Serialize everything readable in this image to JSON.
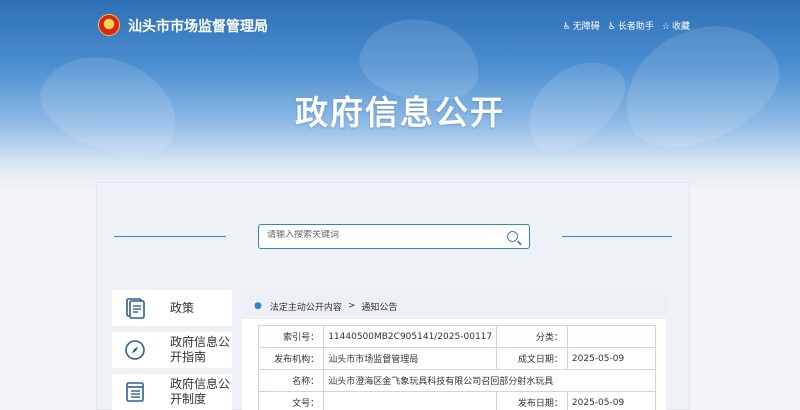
{
  "header": {
    "site_name": "汕头市市场监督管理局",
    "links": [
      {
        "icon": "accessibility-icon",
        "label": "无障碍"
      },
      {
        "icon": "elder-icon",
        "label": "长者助手"
      },
      {
        "icon": "star-icon",
        "label": "收藏"
      }
    ]
  },
  "hero": {
    "title": "政府信息公开"
  },
  "search": {
    "placeholder": "请输入搜索关键词"
  },
  "sidebar": {
    "items": [
      {
        "icon": "document-icon",
        "label": "政策"
      },
      {
        "icon": "compass-icon",
        "label": "政府信息公开指南"
      },
      {
        "icon": "list-icon",
        "label": "政府信息公开制度"
      }
    ]
  },
  "breadcrumb": {
    "items": [
      "法定主动公开内容",
      "通知公告"
    ],
    "separator": ">"
  },
  "meta": {
    "index_label": "索引号：",
    "index_value": "11440500MB2C905141/2025-00117",
    "category_label": "分类：",
    "category_value": "",
    "publisher_label": "发布机构：",
    "publisher_value": "汕头市市场监督管理局",
    "created_label": "成文日期：",
    "created_value": "2025-05-09",
    "name_label": "名称：",
    "name_value": "汕头市澄海区金飞象玩具科技有限公司召回部分射水玩具",
    "docno_label": "文号：",
    "docno_value": "",
    "published_label": "发布日期：",
    "published_value": "2025-05-09"
  },
  "colors": {
    "accent": "#3b82c4",
    "banner_top": "#2e6fb6",
    "panel_bg": "#eef1f5"
  }
}
